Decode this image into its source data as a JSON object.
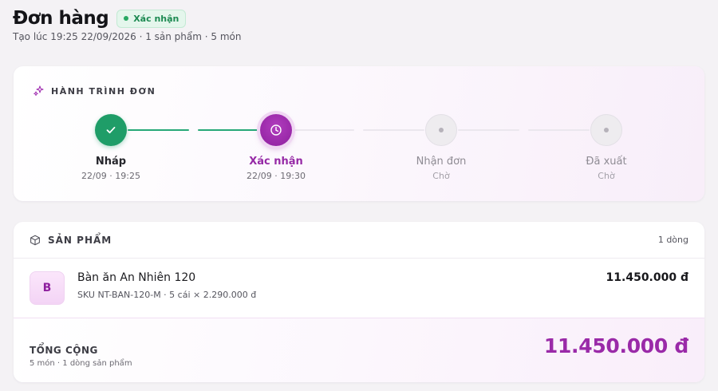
{
  "header": {
    "title": "Đơn hàng",
    "status": "Xác nhận",
    "subtitle": "Tạo lúc 19:25 22/09/2026 · 1 sản phẩm · 5 món"
  },
  "journey": {
    "section_label": "HÀNH TRÌNH ĐƠN",
    "steps": [
      {
        "label": "Nháp",
        "time": "22/09 · 19:25",
        "state": "done"
      },
      {
        "label": "Xác nhận",
        "time": "22/09 · 19:30",
        "state": "active"
      },
      {
        "label": "Nhận đơn",
        "time": "Chờ",
        "state": "pending"
      },
      {
        "label": "Đã xuất",
        "time": "Chờ",
        "state": "pending"
      }
    ]
  },
  "products": {
    "section_label": "SẢN PHẨM",
    "count": "1 dòng",
    "items": [
      {
        "initial": "B",
        "name": "Bàn ăn An Nhiên 120",
        "meta": "SKU NT-BAN-120-M · 5 cái × 2.290.000 đ",
        "price": "11.450.000 đ"
      }
    ],
    "total_label": "TỔNG CỘNG",
    "total_sub": "5 món · 1 dòng sản phẩm",
    "total_value": "11.450.000 đ"
  },
  "colors": {
    "accent": "#962aa6",
    "success": "#1f9d68",
    "background": "#f4f2f5"
  }
}
